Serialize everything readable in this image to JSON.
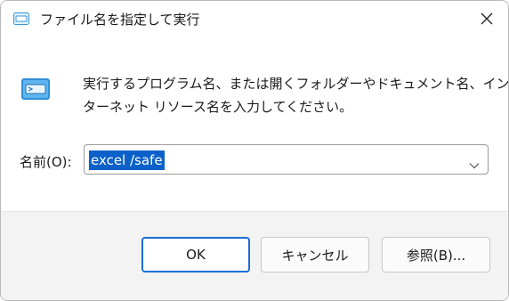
{
  "window": {
    "title": "ファイル名を指定して実行",
    "icon": "run-dialog-icon"
  },
  "main": {
    "description_line1": "実行するプログラム名、または開くフォルダーやドキュメント名、イン",
    "description_line2": "ターネット リソース名を入力してください。",
    "icon": "run-dialog-large-icon"
  },
  "name_field": {
    "label": "名前(O):",
    "value": "excel /safe"
  },
  "buttons": {
    "ok": "OK",
    "cancel": "キャンセル",
    "browse": "参照(B)..."
  },
  "colors": {
    "accent": "#0b61c9",
    "primary_button_border": "#1a6ed8",
    "footer_background": "#f3f3f3"
  }
}
